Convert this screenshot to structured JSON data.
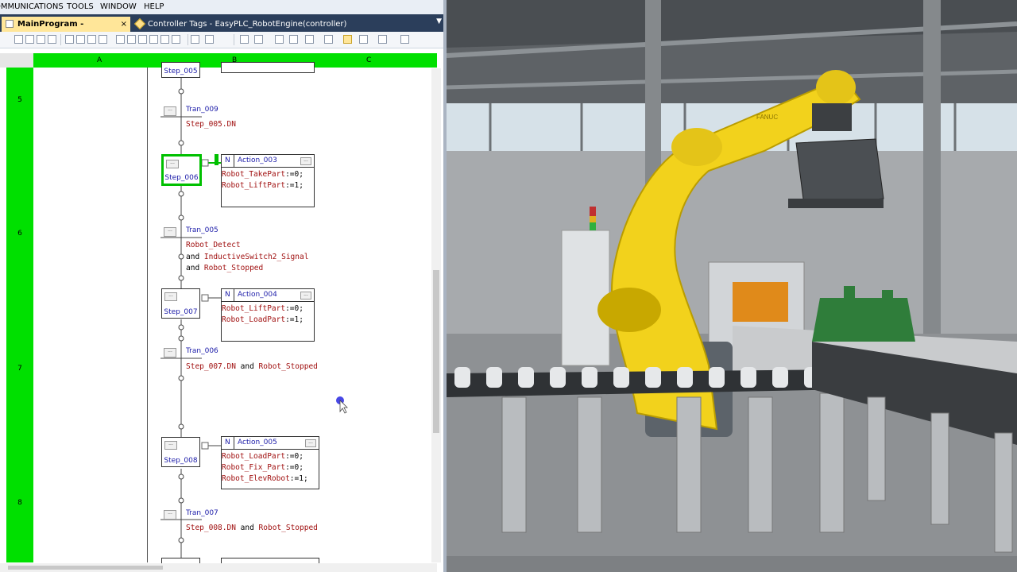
{
  "menu": {
    "items": [
      "COMMUNICATIONS",
      "TOOLS",
      "WINDOW",
      "HELP"
    ]
  },
  "tabs": {
    "active_label": "MainProgram - Robot_SFC",
    "close_glyph": "×",
    "second_label": "Controller Tags - EasyPLC_RobotEngine(controller)",
    "dropdown_glyph": "▼"
  },
  "ruler": {
    "columns": [
      "A",
      "B",
      "C"
    ]
  },
  "rungs": [
    "5",
    "6",
    "7",
    "8"
  ],
  "sfc": {
    "dots": "...",
    "steps": [
      {
        "label": "Step_005",
        "active": false
      },
      {
        "label": "Step_006",
        "active": true
      },
      {
        "label": "Step_007",
        "active": false
      },
      {
        "label": "Step_008",
        "active": false
      }
    ],
    "transitions": [
      {
        "label": "Tran_009",
        "lines": [
          [
            "Step_005.DN"
          ]
        ]
      },
      {
        "label": "Tran_005",
        "lines": [
          [
            "Robot_Detect"
          ],
          [
            "and ",
            "InductiveSwitch2_Signal"
          ],
          [
            "and ",
            "Robot_Stopped"
          ]
        ]
      },
      {
        "label": "Tran_006",
        "lines": [
          [
            "Step_007.DN",
            " and ",
            "Robot_Stopped"
          ]
        ]
      },
      {
        "label": "Tran_007",
        "lines": [
          [
            "Step_008.DN",
            " and ",
            "Robot_Stopped"
          ]
        ]
      }
    ],
    "actions": [
      {
        "qualifier": "N",
        "name": "Action_003",
        "lines": [
          [
            "Robot_TakePart",
            ":=0;"
          ],
          [
            "Robot_LiftPart",
            ":=1;"
          ]
        ]
      },
      {
        "qualifier": "N",
        "name": "Action_004",
        "lines": [
          [
            "Robot_LiftPart",
            ":=0;"
          ],
          [
            "Robot_LoadPart",
            ":=1;"
          ]
        ]
      },
      {
        "qualifier": "N",
        "name": "Action_005",
        "lines": [
          [
            "Robot_LoadPart",
            ":=0;"
          ],
          [
            "Robot_Fix_Part",
            ":=0;"
          ],
          [
            "Robot_ElevRobot",
            ":=1;"
          ]
        ]
      }
    ]
  },
  "scene": {
    "robot_model_text": "FANUC"
  },
  "colors": {
    "sfc_active": "#00c000",
    "ruler_green": "#00e000",
    "robot_yellow": "#f2d21c",
    "tab_bg": "#2b3e5b",
    "active_tab": "#ffe699"
  }
}
